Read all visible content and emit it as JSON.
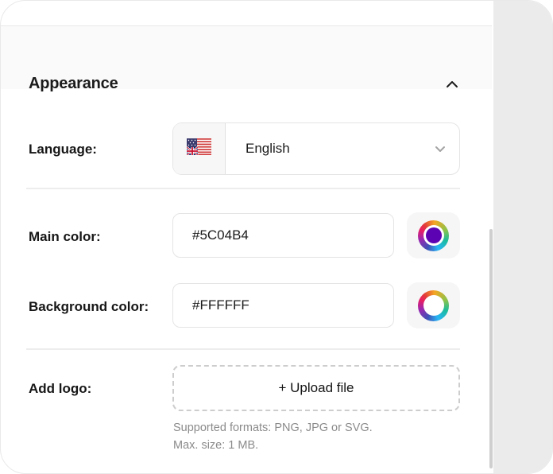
{
  "appearance": {
    "title": "Appearance",
    "language": {
      "label": "Language:",
      "selected": "English"
    },
    "main_color": {
      "label": "Main color:",
      "value": "#5C04B4"
    },
    "background_color": {
      "label": "Background color:",
      "value": "#FFFFFF"
    },
    "logo": {
      "label": "Add logo:",
      "upload_button": "+ Upload file",
      "hint_formats": "Supported formats: PNG, JPG or SVG.",
      "hint_size": "Max. size: 1 MB."
    },
    "colors": {
      "main_swatch_center": "#5C04B4",
      "background_swatch_center": "#FFFFFF",
      "header_bg": "#fafafa",
      "page_background": "#ebebeb"
    }
  }
}
